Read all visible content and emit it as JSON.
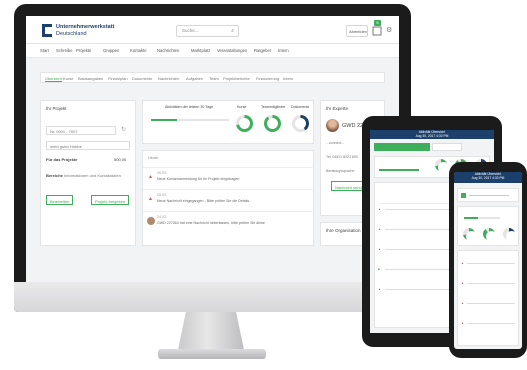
{
  "header": {
    "logo_line1": "Unternehmerwerkstatt",
    "logo_line2": "Deutschland",
    "search_placeholder": "Suche...",
    "account_label": "Abmelden",
    "cart_count": "5"
  },
  "main_nav": [
    "Start",
    "Schreibe",
    "Projekte",
    "Gruppen",
    "Kontakte",
    "Nachrichten",
    "Marktplatz",
    "Veranstaltungen",
    "Ratgeber",
    "Intern"
  ],
  "sub_tabs": [
    "Übersicht",
    "Kurse",
    "Basisangaben",
    "Finanzplan",
    "Dokumente",
    "Nachrichten",
    "Aufgaben",
    "Team",
    "Projektberichte",
    "Finanzierung",
    "Intern"
  ],
  "project_card": {
    "title": "Ihr Projekt",
    "field_value": "Nr. 0001 - 7007",
    "field2": "mein guter Hubbe",
    "price_label": "Für das Projekte",
    "price_value": "500,00",
    "note_label": "Bereiche",
    "note_value": "Informationen und Kontaktdaten",
    "btn_edit": "Bearbeiten",
    "btn_release": "Projekt freigeben"
  },
  "stats_card": {
    "progress_label": "Aktivitäten der letzten 30 Tage",
    "donut_labels": [
      "Kurse",
      "Teammitglieder",
      "Dokumente"
    ]
  },
  "timeline": {
    "heading": "Heute",
    "items": [
      {
        "date": "26.03.",
        "text": "Neue Kundenanmeldung für Ihr Projekt eingetragen"
      },
      {
        "date": "25.03.",
        "text": "Neue Nachricht eingegangen - Bitte prüfen Sie die Details"
      },
      {
        "date": "24.03.",
        "text": "GWD 227364 hat eine Nachricht hinterlassen, bitte prüfen Sie diese"
      }
    ]
  },
  "expert_card": {
    "title": "Ihr Experte",
    "name": "GWD 22736",
    "text": "...connect...",
    "phone": "Tel. 04521 8023 890",
    "lang": "Beratungssprache",
    "btn": "Nachricht senden"
  },
  "org_card": {
    "title": "Ihre Organisation"
  },
  "tablet": {
    "header": "Aktivität Übersicht",
    "sub": "Aug 30, 2017 4:30 PM"
  },
  "phone": {
    "header": "Aktivität Übersicht",
    "sub": "Aug 30, 2017 4:30 PM"
  },
  "colors": {
    "brand": "#1d3f6b",
    "accent": "#3fae5b",
    "alert": "#d9534f"
  }
}
